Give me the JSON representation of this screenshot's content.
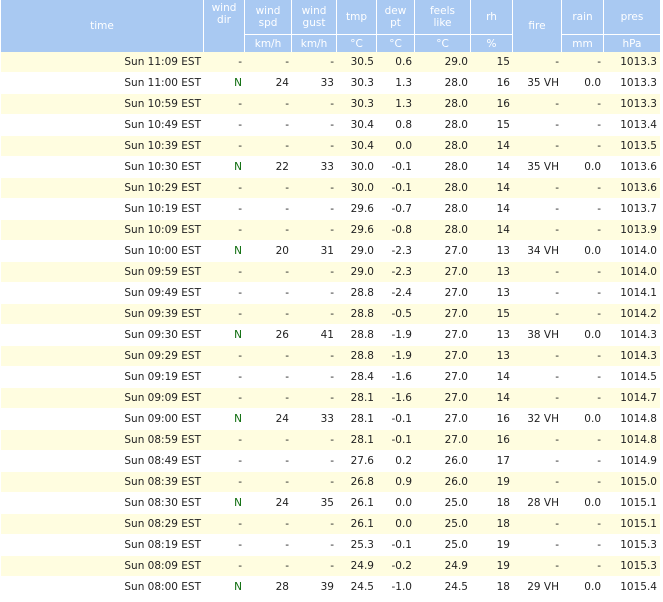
{
  "headers": {
    "time": "time",
    "wind_dir": [
      "wind",
      "dir"
    ],
    "wind_spd": [
      "wind",
      "spd"
    ],
    "wind_gust": [
      "wind",
      "gust"
    ],
    "tmp": "tmp",
    "dew_pt": [
      "dew",
      "pt"
    ],
    "feels_like": [
      "feels",
      "like"
    ],
    "rh": "rh",
    "fire": "fire",
    "rain": "rain",
    "pres": "pres"
  },
  "units": {
    "wind_spd": "km/h",
    "wind_gust": "km/h",
    "tmp": "°C",
    "dew_pt": "°C",
    "feels_like": "°C",
    "rh": "%",
    "rain": "mm",
    "pres": "hPa"
  },
  "rows": [
    {
      "time": "Sun 11:09 EST",
      "dir": "-",
      "spd": "-",
      "gust": "-",
      "tmp": "30.5",
      "dew": "0.6",
      "feels": "29.0",
      "rh": "15",
      "fire": "-",
      "rain": "-",
      "pres": "1013.3"
    },
    {
      "time": "Sun 11:00 EST",
      "dir": "N",
      "spd": "24",
      "gust": "33",
      "tmp": "30.3",
      "dew": "1.3",
      "feels": "28.0",
      "rh": "16",
      "fire": "35 VH",
      "rain": "0.0",
      "pres": "1013.3"
    },
    {
      "time": "Sun 10:59 EST",
      "dir": "-",
      "spd": "-",
      "gust": "-",
      "tmp": "30.3",
      "dew": "1.3",
      "feels": "28.0",
      "rh": "16",
      "fire": "-",
      "rain": "-",
      "pres": "1013.3"
    },
    {
      "time": "Sun 10:49 EST",
      "dir": "-",
      "spd": "-",
      "gust": "-",
      "tmp": "30.4",
      "dew": "0.8",
      "feels": "28.0",
      "rh": "15",
      "fire": "-",
      "rain": "-",
      "pres": "1013.4"
    },
    {
      "time": "Sun 10:39 EST",
      "dir": "-",
      "spd": "-",
      "gust": "-",
      "tmp": "30.4",
      "dew": "0.0",
      "feels": "28.0",
      "rh": "14",
      "fire": "-",
      "rain": "-",
      "pres": "1013.5"
    },
    {
      "time": "Sun 10:30 EST",
      "dir": "N",
      "spd": "22",
      "gust": "33",
      "tmp": "30.0",
      "dew": "-0.1",
      "feels": "28.0",
      "rh": "14",
      "fire": "35 VH",
      "rain": "0.0",
      "pres": "1013.6"
    },
    {
      "time": "Sun 10:29 EST",
      "dir": "-",
      "spd": "-",
      "gust": "-",
      "tmp": "30.0",
      "dew": "-0.1",
      "feels": "28.0",
      "rh": "14",
      "fire": "-",
      "rain": "-",
      "pres": "1013.6"
    },
    {
      "time": "Sun 10:19 EST",
      "dir": "-",
      "spd": "-",
      "gust": "-",
      "tmp": "29.6",
      "dew": "-0.7",
      "feels": "28.0",
      "rh": "14",
      "fire": "-",
      "rain": "-",
      "pres": "1013.7"
    },
    {
      "time": "Sun 10:09 EST",
      "dir": "-",
      "spd": "-",
      "gust": "-",
      "tmp": "29.6",
      "dew": "-0.8",
      "feels": "28.0",
      "rh": "14",
      "fire": "-",
      "rain": "-",
      "pres": "1013.9"
    },
    {
      "time": "Sun 10:00 EST",
      "dir": "N",
      "spd": "20",
      "gust": "31",
      "tmp": "29.0",
      "dew": "-2.3",
      "feels": "27.0",
      "rh": "13",
      "fire": "34 VH",
      "rain": "0.0",
      "pres": "1014.0"
    },
    {
      "time": "Sun 09:59 EST",
      "dir": "-",
      "spd": "-",
      "gust": "-",
      "tmp": "29.0",
      "dew": "-2.3",
      "feels": "27.0",
      "rh": "13",
      "fire": "-",
      "rain": "-",
      "pres": "1014.0"
    },
    {
      "time": "Sun 09:49 EST",
      "dir": "-",
      "spd": "-",
      "gust": "-",
      "tmp": "28.8",
      "dew": "-2.4",
      "feels": "27.0",
      "rh": "13",
      "fire": "-",
      "rain": "-",
      "pres": "1014.1"
    },
    {
      "time": "Sun 09:39 EST",
      "dir": "-",
      "spd": "-",
      "gust": "-",
      "tmp": "28.8",
      "dew": "-0.5",
      "feels": "27.0",
      "rh": "15",
      "fire": "-",
      "rain": "-",
      "pres": "1014.2"
    },
    {
      "time": "Sun 09:30 EST",
      "dir": "N",
      "spd": "26",
      "gust": "41",
      "tmp": "28.8",
      "dew": "-1.9",
      "feels": "27.0",
      "rh": "13",
      "fire": "38 VH",
      "rain": "0.0",
      "pres": "1014.3"
    },
    {
      "time": "Sun 09:29 EST",
      "dir": "-",
      "spd": "-",
      "gust": "-",
      "tmp": "28.8",
      "dew": "-1.9",
      "feels": "27.0",
      "rh": "13",
      "fire": "-",
      "rain": "-",
      "pres": "1014.3"
    },
    {
      "time": "Sun 09:19 EST",
      "dir": "-",
      "spd": "-",
      "gust": "-",
      "tmp": "28.4",
      "dew": "-1.6",
      "feels": "27.0",
      "rh": "14",
      "fire": "-",
      "rain": "-",
      "pres": "1014.5"
    },
    {
      "time": "Sun 09:09 EST",
      "dir": "-",
      "spd": "-",
      "gust": "-",
      "tmp": "28.1",
      "dew": "-1.6",
      "feels": "27.0",
      "rh": "14",
      "fire": "-",
      "rain": "-",
      "pres": "1014.7"
    },
    {
      "time": "Sun 09:00 EST",
      "dir": "N",
      "spd": "24",
      "gust": "33",
      "tmp": "28.1",
      "dew": "-0.1",
      "feels": "27.0",
      "rh": "16",
      "fire": "32 VH",
      "rain": "0.0",
      "pres": "1014.8"
    },
    {
      "time": "Sun 08:59 EST",
      "dir": "-",
      "spd": "-",
      "gust": "-",
      "tmp": "28.1",
      "dew": "-0.1",
      "feels": "27.0",
      "rh": "16",
      "fire": "-",
      "rain": "-",
      "pres": "1014.8"
    },
    {
      "time": "Sun 08:49 EST",
      "dir": "-",
      "spd": "-",
      "gust": "-",
      "tmp": "27.6",
      "dew": "0.2",
      "feels": "26.0",
      "rh": "17",
      "fire": "-",
      "rain": "-",
      "pres": "1014.9"
    },
    {
      "time": "Sun 08:39 EST",
      "dir": "-",
      "spd": "-",
      "gust": "-",
      "tmp": "26.8",
      "dew": "0.9",
      "feels": "26.0",
      "rh": "19",
      "fire": "-",
      "rain": "-",
      "pres": "1015.0"
    },
    {
      "time": "Sun 08:30 EST",
      "dir": "N",
      "spd": "24",
      "gust": "35",
      "tmp": "26.1",
      "dew": "0.0",
      "feels": "25.0",
      "rh": "18",
      "fire": "28 VH",
      "rain": "0.0",
      "pres": "1015.1"
    },
    {
      "time": "Sun 08:29 EST",
      "dir": "-",
      "spd": "-",
      "gust": "-",
      "tmp": "26.1",
      "dew": "0.0",
      "feels": "25.0",
      "rh": "18",
      "fire": "-",
      "rain": "-",
      "pres": "1015.1"
    },
    {
      "time": "Sun 08:19 EST",
      "dir": "-",
      "spd": "-",
      "gust": "-",
      "tmp": "25.3",
      "dew": "-0.1",
      "feels": "25.0",
      "rh": "19",
      "fire": "-",
      "rain": "-",
      "pres": "1015.3"
    },
    {
      "time": "Sun 08:09 EST",
      "dir": "-",
      "spd": "-",
      "gust": "-",
      "tmp": "24.9",
      "dew": "-0.2",
      "feels": "24.9",
      "rh": "19",
      "fire": "-",
      "rain": "-",
      "pres": "1015.3"
    },
    {
      "time": "Sun 08:00 EST",
      "dir": "N",
      "spd": "28",
      "gust": "39",
      "tmp": "24.5",
      "dew": "-1.0",
      "feels": "24.5",
      "rh": "18",
      "fire": "29 VH",
      "rain": "0.0",
      "pres": "1015.4"
    }
  ],
  "colors": {
    "header_bg": "#a9c9f2",
    "row_alt_bg": "#fffde0",
    "temp_text": "#b01818",
    "wind_text": "#0a6a0a"
  }
}
